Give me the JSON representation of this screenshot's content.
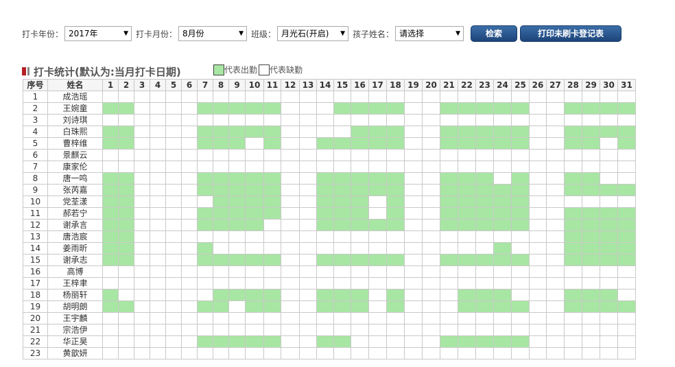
{
  "filters": {
    "year_label": "打卡年份：",
    "year_value": "2017年",
    "month_label": "打卡月份：",
    "month_value": "8月份",
    "class_label": "班级：",
    "class_value": "月光石(开启)",
    "child_label": "孩子姓名：",
    "child_value": "请选择",
    "search_button": "检索",
    "print_button": "打印未刷卡登记表"
  },
  "section": {
    "title": "打卡统计(默认为:当月打卡日期)",
    "legend_present": "代表出勤",
    "legend_absent": "代表缺勤"
  },
  "colors": {
    "present": "#a8e6a3",
    "absent": "#ffffff",
    "button": "#2a5a94"
  },
  "table": {
    "header_index": "序号",
    "header_name": "姓名",
    "days": [
      "1",
      "2",
      "3",
      "4",
      "5",
      "6",
      "7",
      "8",
      "9",
      "10",
      "11",
      "12",
      "13",
      "14",
      "15",
      "16",
      "17",
      "18",
      "19",
      "20",
      "21",
      "22",
      "23",
      "24",
      "25",
      "26",
      "27",
      "28",
      "29",
      "30",
      "31"
    ],
    "rows": [
      {
        "no": "1",
        "name": "成浩瑶",
        "present": []
      },
      {
        "no": "2",
        "name": "王婉童",
        "present": [
          1,
          2,
          7,
          8,
          9,
          10,
          11,
          15,
          16,
          17,
          18,
          21,
          22,
          23,
          24,
          25,
          28,
          29,
          30,
          31
        ]
      },
      {
        "no": "3",
        "name": "刘诗琪",
        "present": []
      },
      {
        "no": "4",
        "name": "白珠熙",
        "present": [
          1,
          2,
          7,
          8,
          9,
          10,
          11,
          16,
          17,
          18,
          21,
          22,
          23,
          24,
          25,
          28,
          29,
          30,
          31
        ]
      },
      {
        "no": "5",
        "name": "曹梓维",
        "present": [
          1,
          2,
          7,
          8,
          9,
          11,
          14,
          15,
          16,
          17,
          18,
          21,
          22,
          23,
          24,
          25,
          28,
          29,
          31
        ]
      },
      {
        "no": "6",
        "name": "景麒云",
        "present": []
      },
      {
        "no": "7",
        "name": "康家伦",
        "present": []
      },
      {
        "no": "8",
        "name": "唐一鸣",
        "present": [
          1,
          2,
          7,
          8,
          9,
          10,
          11,
          14,
          15,
          16,
          17,
          18,
          21,
          22,
          23,
          25,
          28,
          29
        ]
      },
      {
        "no": "9",
        "name": "张芮嘉",
        "present": [
          1,
          2,
          7,
          8,
          9,
          10,
          11,
          14,
          15,
          16,
          17,
          18,
          21,
          22,
          23,
          24,
          25,
          28,
          29,
          30,
          31
        ]
      },
      {
        "no": "10",
        "name": "党荃漾",
        "present": [
          1,
          2,
          8,
          9,
          10,
          11,
          14,
          15,
          16,
          18,
          21,
          22,
          23,
          24,
          25
        ]
      },
      {
        "no": "11",
        "name": "郝若宁",
        "present": [
          1,
          2,
          7,
          8,
          9,
          10,
          11,
          14,
          15,
          16,
          18,
          21,
          22,
          23,
          24,
          25,
          28,
          29,
          30,
          31
        ]
      },
      {
        "no": "12",
        "name": "谢承言",
        "present": [
          1,
          2,
          7,
          8,
          9,
          10,
          14,
          15,
          16,
          17,
          18,
          21,
          22,
          23,
          24,
          25,
          28,
          29,
          30,
          31
        ]
      },
      {
        "no": "13",
        "name": "唐浩宸",
        "present": [
          1,
          2,
          28,
          29,
          30,
          31
        ]
      },
      {
        "no": "14",
        "name": "姜雨昕",
        "present": [
          1,
          2,
          7,
          24,
          28,
          29,
          30,
          31
        ]
      },
      {
        "no": "15",
        "name": "谢承志",
        "present": [
          1,
          2,
          7,
          8,
          9,
          10,
          11,
          14,
          15,
          16,
          17,
          18,
          21,
          22,
          23,
          24,
          25,
          28,
          29,
          30,
          31
        ]
      },
      {
        "no": "16",
        "name": "高博",
        "present": []
      },
      {
        "no": "17",
        "name": "王梓聿",
        "present": []
      },
      {
        "no": "18",
        "name": "杨丽轩",
        "present": [
          1,
          8,
          9,
          10,
          11,
          14,
          15,
          16,
          18,
          22,
          23,
          24,
          28,
          29,
          30
        ]
      },
      {
        "no": "19",
        "name": "胡明朗",
        "present": [
          1,
          2,
          7,
          8,
          10,
          11,
          14,
          15,
          16,
          18,
          22,
          23,
          24,
          25,
          28,
          29,
          30,
          31
        ]
      },
      {
        "no": "20",
        "name": "王宇麟",
        "present": []
      },
      {
        "no": "21",
        "name": "宗浩伊",
        "present": []
      },
      {
        "no": "22",
        "name": "华正昊",
        "present": [
          7,
          8,
          9,
          10,
          11,
          14,
          15,
          21,
          22,
          23,
          24,
          25
        ]
      },
      {
        "no": "23",
        "name": "黄歆妍",
        "present": []
      }
    ]
  }
}
